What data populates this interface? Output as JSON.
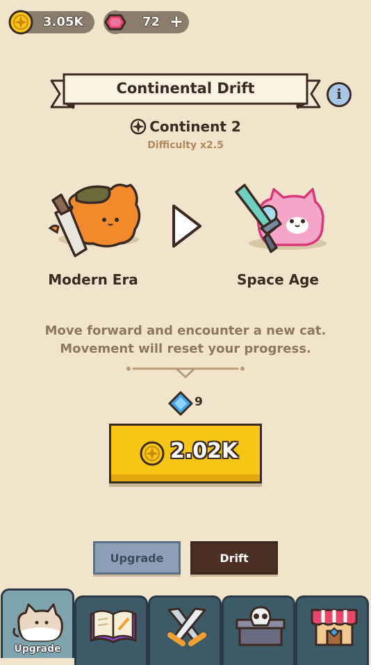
{
  "currency": {
    "coins": "3.05K",
    "gems": "72",
    "gems_add_label": "+"
  },
  "header": {
    "title": "Continental Drift",
    "info_icon": "info-icon",
    "info_label": "i"
  },
  "continent": {
    "name": "Continent 2",
    "difficulty": "Difficulty x2.5"
  },
  "eras": {
    "current": "Modern Era",
    "next": "Space Age"
  },
  "description": {
    "line1": "Move forward and encounter a new cat.",
    "line2": "Movement will reset your progress."
  },
  "reward": {
    "gem_amount": "9"
  },
  "cost": {
    "value": "2.02K"
  },
  "toggles": {
    "upgrade": "Upgrade",
    "drift": "Drift"
  },
  "nav": {
    "tabs": [
      {
        "label": "Upgrade",
        "icon": "cat-icon",
        "active": true
      },
      {
        "label": "",
        "icon": "book-icon",
        "active": false
      },
      {
        "label": "",
        "icon": "crossed-swords-icon",
        "active": false
      },
      {
        "label": "",
        "icon": "skull-chest-icon",
        "active": false
      },
      {
        "label": "",
        "icon": "shop-icon",
        "active": false
      }
    ]
  },
  "colors": {
    "background": "#f0e4cc",
    "gold": "#f7c614",
    "dark": "#3b2a22",
    "nav": "#3e5a66"
  }
}
